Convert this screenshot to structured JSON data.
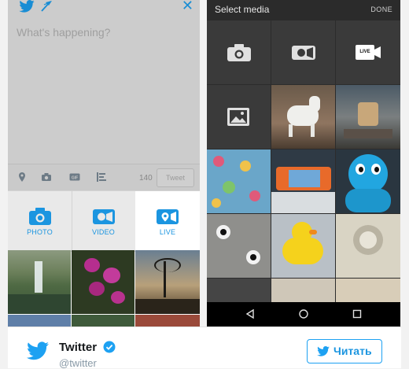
{
  "compose": {
    "placeholder": "What's happening?",
    "char_count": "140",
    "tweet_label": "Tweet"
  },
  "media_options": [
    {
      "label": "PHOTO"
    },
    {
      "label": "VIDEO"
    },
    {
      "label": "LIVE"
    }
  ],
  "picker": {
    "title": "Select media",
    "done_label": "DONE",
    "live_badge": "LIVE"
  },
  "card": {
    "name": "Twitter",
    "handle": "@twitter",
    "follow_label": "Читать"
  },
  "colors": {
    "twitter_blue": "#1da1f2",
    "picker_bg": "#2c2c2c"
  }
}
